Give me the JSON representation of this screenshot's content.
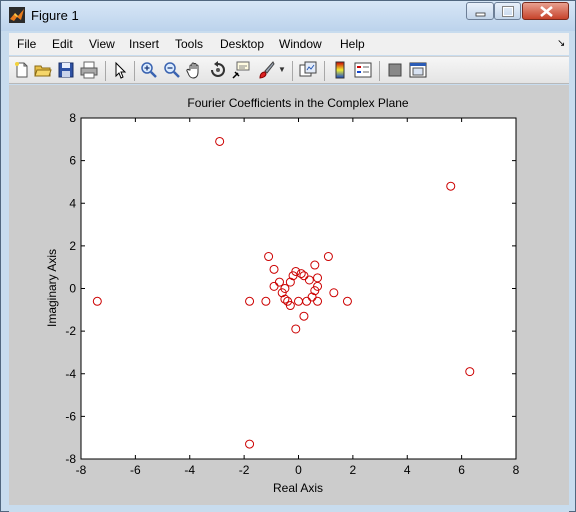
{
  "window": {
    "title": "Figure 1",
    "colors": {
      "titlebar": "#c8dcee",
      "figure_bg": "#cccccc",
      "marker": "#cc0000"
    }
  },
  "menu": {
    "items": [
      "File",
      "Edit",
      "View",
      "Insert",
      "Tools",
      "Desktop",
      "Window",
      "Help"
    ]
  },
  "toolbar": {
    "icons": [
      "new-figure-icon",
      "open-file-icon",
      "save-icon",
      "print-icon",
      "pointer-arrow-icon",
      "zoom-in-icon",
      "zoom-out-icon",
      "pan-hand-icon",
      "rotate-3d-icon",
      "data-cursor-icon",
      "brush-icon",
      "link-plot-icon",
      "colorbar-icon",
      "legend-icon",
      "hide-plot-tools-icon",
      "show-plot-tools-icon"
    ]
  },
  "chart_data": {
    "type": "scatter",
    "title": "Fourier Coefficients in the Complex Plane",
    "xlabel": "Real Axis",
    "ylabel": "Imaginary Axis",
    "xlim": [
      -8,
      8
    ],
    "ylim": [
      -8,
      8
    ],
    "xticks": [
      -8,
      -6,
      -4,
      -2,
      0,
      2,
      4,
      6,
      8
    ],
    "yticks": [
      -8,
      -6,
      -4,
      -2,
      0,
      2,
      4,
      6,
      8
    ],
    "grid": false,
    "marker": "open-circle",
    "color": "#cc0000",
    "points": [
      [
        -7.4,
        -0.6
      ],
      [
        -2.9,
        6.9
      ],
      [
        5.6,
        4.8
      ],
      [
        6.3,
        -3.9
      ],
      [
        -1.8,
        -7.3
      ],
      [
        -1.8,
        -0.6
      ],
      [
        -1.2,
        -0.6
      ],
      [
        1.8,
        -0.6
      ],
      [
        -1.1,
        1.5
      ],
      [
        1.1,
        1.5
      ],
      [
        -0.9,
        0.9
      ],
      [
        0.6,
        1.1
      ],
      [
        -0.9,
        0.1
      ],
      [
        -0.7,
        0.3
      ],
      [
        -0.6,
        -0.2
      ],
      [
        -0.5,
        -0.5
      ],
      [
        -0.4,
        -0.6
      ],
      [
        -0.3,
        -0.8
      ],
      [
        -0.2,
        0.6
      ],
      [
        -0.3,
        0.3
      ],
      [
        -0.1,
        0.8
      ],
      [
        0.1,
        0.7
      ],
      [
        0.2,
        0.6
      ],
      [
        0.4,
        0.4
      ],
      [
        0.7,
        0.5
      ],
      [
        0.7,
        0.1
      ],
      [
        0.6,
        -0.1
      ],
      [
        0.5,
        -0.4
      ],
      [
        0.7,
        -0.6
      ],
      [
        0.3,
        -0.6
      ],
      [
        0.0,
        -0.6
      ],
      [
        0.2,
        -1.3
      ],
      [
        -0.1,
        -1.9
      ],
      [
        1.3,
        -0.2
      ],
      [
        -0.5,
        0.0
      ]
    ]
  }
}
